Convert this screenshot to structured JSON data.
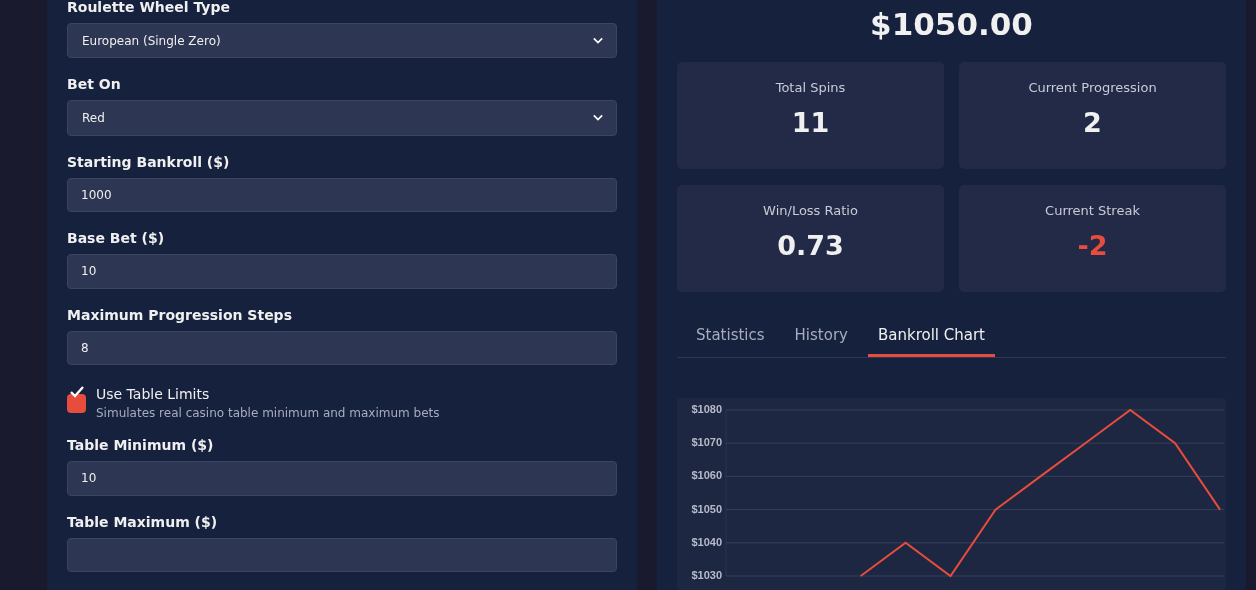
{
  "settings": {
    "fields": [
      {
        "kind": "select",
        "label": "Roulette Wheel Type",
        "value": "European (Single Zero)"
      },
      {
        "kind": "select",
        "label": "Bet On",
        "value": "Red"
      },
      {
        "kind": "input",
        "label": "Starting Bankroll ($)",
        "value": "1000"
      },
      {
        "kind": "input",
        "label": "Base Bet ($)",
        "value": "10"
      },
      {
        "kind": "input",
        "label": "Maximum Progression Steps",
        "value": "8"
      },
      {
        "kind": "checkbox",
        "label": "Use Table Limits",
        "hint": "Simulates real casino table minimum and maximum bets",
        "checked": true
      },
      {
        "kind": "input",
        "label": "Table Minimum ($)",
        "value": "10"
      },
      {
        "kind": "input",
        "label": "Table Maximum ($)"
      }
    ]
  },
  "results": {
    "bankroll": "$1050.00",
    "stats": [
      {
        "label": "Total Spins",
        "value": "11",
        "negative": false
      },
      {
        "label": "Current Progression",
        "value": "2",
        "negative": false
      },
      {
        "label": "Win/Loss Ratio",
        "value": "0.73",
        "negative": false
      },
      {
        "label": "Current Streak",
        "value": "-2",
        "negative": true
      }
    ],
    "tabs": [
      {
        "label": "Statistics",
        "selected": false
      },
      {
        "label": "History",
        "selected": false
      },
      {
        "label": "Bankroll Chart",
        "selected": true
      }
    ],
    "chart_data": {
      "type": "line",
      "grid": true,
      "ylim": [
        1030,
        1080
      ],
      "series": [
        {
          "color": "#e74c3c",
          "values": [
            null,
            null,
            null,
            1030,
            1040,
            1030,
            1050,
            1060,
            1070,
            1080,
            1070,
            1050
          ]
        }
      ],
      "yticks": [
        {
          "value": 1030,
          "label": "$1030"
        },
        {
          "value": 1040,
          "label": "$1040"
        },
        {
          "value": 1050,
          "label": "$1050"
        },
        {
          "value": 1060,
          "label": "$1060"
        },
        {
          "value": 1070,
          "label": "$1070"
        },
        {
          "value": 1080,
          "label": "$1080"
        }
      ]
    }
  }
}
